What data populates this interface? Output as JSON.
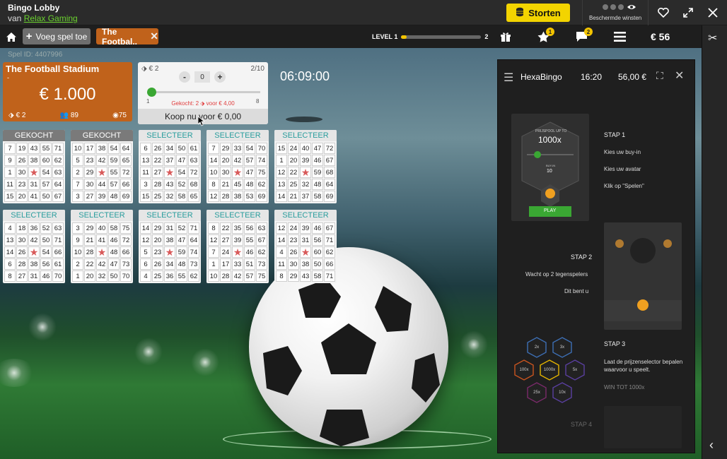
{
  "window": {
    "title": "Bingo Lobby",
    "provider_prefix": "van",
    "provider": "Relax Gaming",
    "deposit_label": "Storten",
    "protected_label": "Beschermde winsten"
  },
  "nav": {
    "add_game_label": "Voeg spel toe",
    "game_tab_label": "The Footbal..",
    "level_label": "LEVEL 1",
    "level_next": "2",
    "level_progress": 0.07,
    "stars_badge": "1",
    "chat_badge": "2",
    "balance": "€ 56"
  },
  "game": {
    "spel_id": "Spel ID: 4407996",
    "room_name": "The Football Stadium",
    "room_sub": "-",
    "jackpot": "€ 1.000",
    "ticket_price": "€ 2",
    "players": "89",
    "balls": "75",
    "timer": "06:09:00"
  },
  "buy": {
    "price": "€ 2",
    "count": "2/10",
    "minus": "-",
    "plus": "+",
    "quantity": "0",
    "min": "1",
    "max": "8",
    "bought_text": "Gekocht: 2",
    "bought_for": "voor € 4,00",
    "buy_now_label": "Koop nu voor € 0,00"
  },
  "cards": [
    {
      "status": "GEKOCHT",
      "bought": true,
      "nums": [
        "7",
        "19",
        "43",
        "55",
        "71",
        "9",
        "26",
        "38",
        "60",
        "62",
        "1",
        "30",
        "★",
        "54",
        "63",
        "11",
        "23",
        "31",
        "57",
        "64",
        "15",
        "20",
        "41",
        "50",
        "67"
      ]
    },
    {
      "status": "GEKOCHT",
      "bought": true,
      "nums": [
        "10",
        "17",
        "38",
        "54",
        "64",
        "5",
        "23",
        "42",
        "59",
        "65",
        "2",
        "29",
        "★",
        "55",
        "72",
        "7",
        "30",
        "44",
        "57",
        "66",
        "3",
        "27",
        "39",
        "48",
        "69"
      ]
    },
    {
      "status": "SELECTEER",
      "bought": false,
      "nums": [
        "6",
        "26",
        "34",
        "50",
        "61",
        "13",
        "22",
        "37",
        "47",
        "63",
        "11",
        "27",
        "★",
        "54",
        "72",
        "3",
        "28",
        "43",
        "52",
        "68",
        "15",
        "25",
        "32",
        "58",
        "65"
      ]
    },
    {
      "status": "SELECTEER",
      "bought": false,
      "nums": [
        "7",
        "29",
        "33",
        "54",
        "70",
        "14",
        "20",
        "42",
        "57",
        "74",
        "10",
        "30",
        "★",
        "47",
        "75",
        "8",
        "21",
        "45",
        "48",
        "62",
        "12",
        "28",
        "38",
        "53",
        "69"
      ]
    },
    {
      "status": "SELECTEER",
      "bought": false,
      "nums": [
        "15",
        "24",
        "40",
        "47",
        "72",
        "1",
        "20",
        "39",
        "46",
        "67",
        "12",
        "22",
        "★",
        "59",
        "68",
        "13",
        "25",
        "32",
        "48",
        "64",
        "14",
        "21",
        "37",
        "58",
        "69"
      ]
    },
    {
      "status": "SELECTEER",
      "bought": false,
      "nums": [
        "4",
        "18",
        "36",
        "52",
        "63",
        "13",
        "30",
        "42",
        "50",
        "71",
        "14",
        "26",
        "★",
        "54",
        "66",
        "6",
        "28",
        "38",
        "56",
        "61",
        "8",
        "27",
        "31",
        "46",
        "70"
      ]
    },
    {
      "status": "SELECTEER",
      "bought": false,
      "nums": [
        "3",
        "29",
        "40",
        "58",
        "75",
        "9",
        "21",
        "41",
        "46",
        "72",
        "10",
        "28",
        "★",
        "48",
        "66",
        "2",
        "22",
        "42",
        "47",
        "73",
        "1",
        "20",
        "32",
        "50",
        "70"
      ]
    },
    {
      "status": "SELECTEER",
      "bought": false,
      "nums": [
        "14",
        "29",
        "31",
        "52",
        "71",
        "12",
        "20",
        "38",
        "47",
        "64",
        "5",
        "23",
        "★",
        "59",
        "74",
        "6",
        "26",
        "34",
        "48",
        "73",
        "4",
        "25",
        "36",
        "55",
        "62"
      ]
    },
    {
      "status": "SELECTEER",
      "bought": false,
      "nums": [
        "8",
        "22",
        "35",
        "56",
        "63",
        "12",
        "27",
        "39",
        "55",
        "67",
        "7",
        "24",
        "★",
        "46",
        "62",
        "1",
        "17",
        "33",
        "51",
        "73",
        "10",
        "28",
        "42",
        "57",
        "75"
      ]
    },
    {
      "status": "SELECTEER",
      "bought": false,
      "nums": [
        "12",
        "24",
        "39",
        "46",
        "67",
        "14",
        "23",
        "31",
        "56",
        "71",
        "4",
        "26",
        "★",
        "60",
        "62",
        "11",
        "30",
        "38",
        "50",
        "66",
        "8",
        "29",
        "43",
        "58",
        "71"
      ]
    }
  ],
  "panel": {
    "title": "HexaBingo",
    "time": "16:20",
    "balance": "56,00 €",
    "step1": "STAP 1",
    "step1_a": "Kies uw buy-in",
    "step1_b": "Kies uw avatar",
    "step1_c": "Klik op \"Spelen\"",
    "mock_prize_label": "PRIJSPOOL UP TO",
    "mock_prize": "1000x",
    "mock_buyin_label": "BUY-IN",
    "mock_buyin": "10",
    "mock_play": "PLAY",
    "step2": "STAP 2",
    "step2_a": "Wacht op 2 tegenspelers",
    "step2_b": "Dit bent u",
    "step3": "STAP 3",
    "step3_a": "Laat de prijzenselector bepalen waarvoor u speelt.",
    "step3_b": "WIN TOT 1000x",
    "step4": "STAP 4",
    "hexes": [
      "2x",
      "3x",
      "100x",
      "1000x",
      "5x",
      "25x",
      "10x"
    ]
  }
}
